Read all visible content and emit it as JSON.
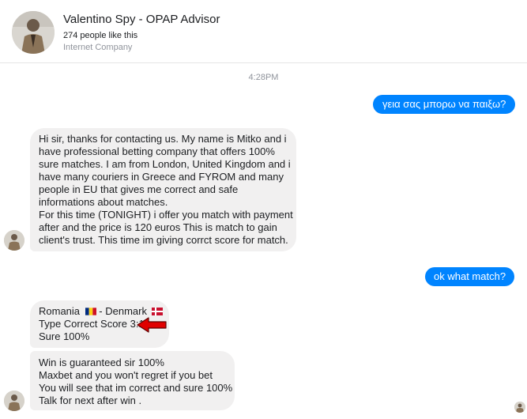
{
  "header": {
    "page_name": "Valentino Spy - OPAP Advisor",
    "likes": "274 people like this",
    "category": "Internet Company"
  },
  "timestamp": "4:28PM",
  "messages": {
    "m1": "γεια σας μπορω να παιξω?",
    "m2": [
      "Hi sir, thanks for contacting us. My name is  Mitko  and i",
      "have professional betting company that offers 100%",
      "sure matches. I am from London, United Kingdom and i",
      "have many couriers in Greece and FYROM and many",
      "people in EU that gives me correct and safe",
      "informations about matches.",
      "For this time (TONIGHT) i offer you match with payment",
      "after and the price is 120 euros  This is match to gain",
      "client's trust. This time im giving corrct score for match."
    ],
    "m3": "ok what match?",
    "m4": {
      "team1": "Romania",
      "separator": "-",
      "team2": "Denmark",
      "type": "Type Correct Score 3:1",
      "sure": "Sure 100%"
    },
    "m5": [
      "Win is guaranteed sir 100%",
      "Maxbet and you won't regret if you bet",
      "You will see that im correct and sure 100%",
      "Talk for next after win ."
    ]
  },
  "colors": {
    "outgoing_bubble": "#0084ff",
    "incoming_bubble": "#f1f0f0",
    "arrow": "#e00000",
    "flag_romania": [
      "#002b7f",
      "#fcd116",
      "#ce1126"
    ],
    "flag_denmark": [
      "#c8102e",
      "#ffffff"
    ]
  },
  "icons": {
    "page_avatar": "profile-photo",
    "sender_avatar": "profile-photo",
    "seen_indicator": "seen-avatar",
    "annotation": "red-arrow"
  }
}
